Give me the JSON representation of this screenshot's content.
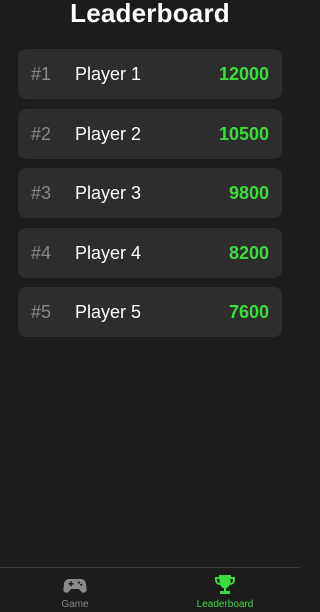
{
  "header": {
    "title": "Leaderboard"
  },
  "leaderboard": {
    "entries": [
      {
        "rank": "#1",
        "name": "Player 1",
        "score": "12000"
      },
      {
        "rank": "#2",
        "name": "Player 2",
        "score": "10500"
      },
      {
        "rank": "#3",
        "name": "Player 3",
        "score": "9800"
      },
      {
        "rank": "#4",
        "name": "Player 4",
        "score": "8200"
      },
      {
        "rank": "#5",
        "name": "Player 5",
        "score": "7600"
      }
    ]
  },
  "bottom_nav": {
    "items": [
      {
        "label": "Game",
        "icon": "gamepad-icon",
        "active": false
      },
      {
        "label": "Leaderboard",
        "icon": "trophy-icon",
        "active": true
      }
    ]
  },
  "colors": {
    "background": "#1c1c1c",
    "card": "#2d2d2d",
    "accent": "#3ddc3d",
    "muted": "#8a8a8a"
  }
}
